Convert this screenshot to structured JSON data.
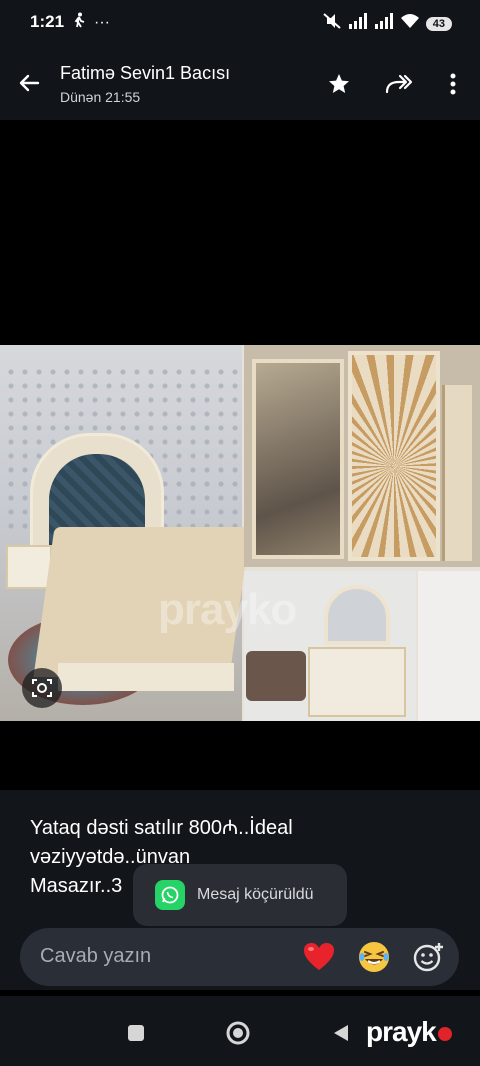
{
  "status_bar": {
    "time": "1:21",
    "more_indicator": "···",
    "battery_level": "43",
    "icons": [
      "walk-icon",
      "mute-icon",
      "signal-icon",
      "signal-icon",
      "wifi-icon",
      "battery-icon"
    ]
  },
  "header": {
    "title": "Fatimə Sevin1 Bacısı",
    "subtitle": "Dünən 21:55",
    "icons": [
      "back-arrow-icon",
      "star-icon",
      "forward-icon",
      "more-vert-icon"
    ]
  },
  "photo": {
    "watermark": "prayko",
    "lens_icon": "lens-icon"
  },
  "message": {
    "caption": "Yataq dəsti satılır 800₼..İdeal\nvəziyyətdə..ünvan\nMasazır..3"
  },
  "toast": {
    "text": "Mesaj köçürüldü",
    "icon": "whatsapp-icon"
  },
  "reply": {
    "placeholder": "Cavab yazın",
    "reactions": [
      "heart-emoji",
      "laughing-emoji",
      "add-emoji-icon"
    ]
  },
  "nav": {
    "icons": [
      "recents-icon",
      "home-icon",
      "back-triangle-icon"
    ],
    "brand": "prayk"
  },
  "colors": {
    "toast_green": "#25d366",
    "heart_red": "#e8232b",
    "brand_dot": "#e0242a"
  }
}
